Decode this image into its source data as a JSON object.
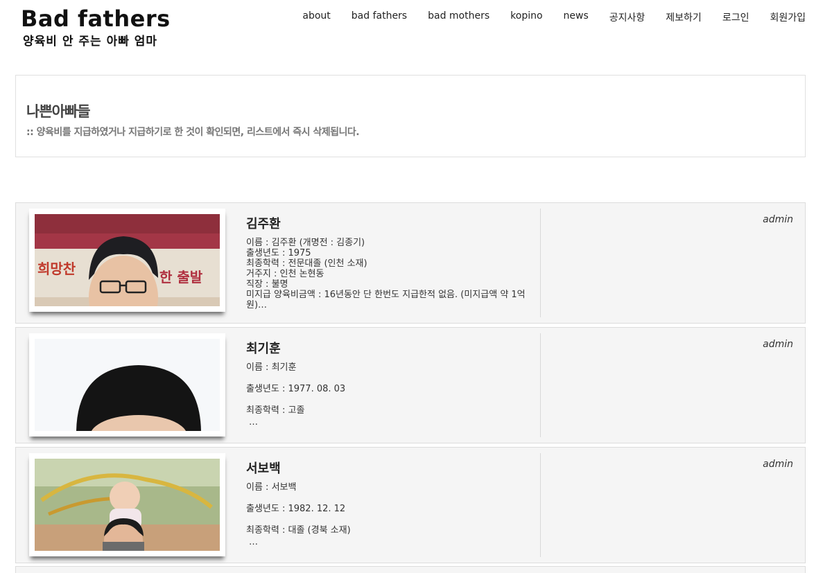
{
  "header": {
    "title": "Bad fathers",
    "subtitle": "양육비 안 주는 아빠 엄마",
    "nav": [
      {
        "label": "about"
      },
      {
        "label": "bad fathers"
      },
      {
        "label": "bad mothers"
      },
      {
        "label": "kopino"
      },
      {
        "label": "news"
      },
      {
        "label": "공지사항"
      },
      {
        "label": "제보하기"
      },
      {
        "label": "로그인"
      },
      {
        "label": "회원가입"
      }
    ]
  },
  "page": {
    "title": "나쁜아빠들",
    "description": ":: 양육비를 지급하였거나 지급하기로 한 것이 확인되면, 리스트에서 즉시 삭제됩니다."
  },
  "posts": [
    {
      "name": "김주환",
      "author": "admin",
      "lines": [
        "이름 : 김주환 (개명전 : 김종기)",
        "출생년도 : 1975",
        "최종학력 : 전문대졸 (인천 소재)",
        "거주지 : 인천 논현동",
        "직장 : 불명",
        "미지급 양육비금액 : 16년동안 단 한번도 지급한적 없음. (미지급액 약 1억원)…"
      ],
      "photo_sign_left": "희망찬",
      "photo_sign_right": "한 출발"
    },
    {
      "name": "최기훈",
      "author": "admin",
      "lines": [
        "이름 : 최기훈",
        "출생년도 : 1977. 08. 03",
        "최종학력 : 고졸"
      ],
      "more": "…"
    },
    {
      "name": "서보백",
      "author": "admin",
      "lines": [
        "이름 : 서보백",
        "출생년도 : 1982. 12. 12",
        "최종학력 : 대졸 (경북 소재)"
      ],
      "more": "…"
    }
  ],
  "colors": {
    "post_bg": "#f5f5f5",
    "border": "#dcdcdc",
    "title_text": "#444444",
    "desc_text": "#777777"
  }
}
